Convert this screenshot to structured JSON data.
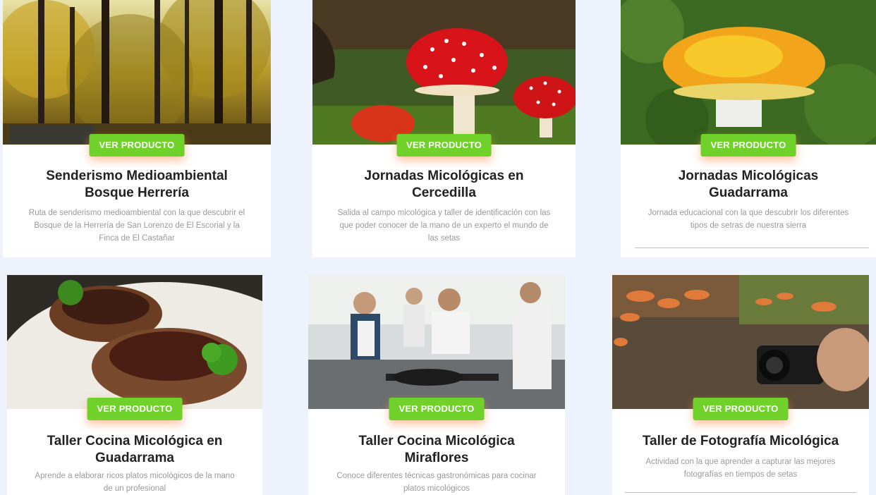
{
  "colors": {
    "button": "#6fd12a",
    "background": "#eef2fc"
  },
  "cards": [
    {
      "button": "VER PRODUCTO",
      "title": "Senderismo Medioambiental Bosque Herrería",
      "description": "Ruta de senderismo medioambiental con la que descubrir  el Bosque de la Herrería de San Lorenzo de El Escorial y la Finca de El Castañar"
    },
    {
      "button": "VER PRODUCTO",
      "title": "Jornadas Micológicas en Cercedilla",
      "description": "Salida al campo micológica y taller de identificación con las que poder conocer de la mano de un experto el mundo de las setas"
    },
    {
      "button": "VER PRODUCTO",
      "title": "Jornadas Micológicas Guadarrama",
      "description": "Jornada educacional con la que descubrir los diferentes tipos de setras de nuestra sierra"
    },
    {
      "button": "VER PRODUCTO",
      "title": "Taller Cocina Micológica en Guadarrama",
      "description": "Aprende a elaborar ricos platos micológicos de la mano de un profesional"
    },
    {
      "button": "VER PRODUCTO",
      "title": "Taller Cocina Micológica Miraflores",
      "description": "Conoce diferentes técnicas gastronómicas para cocinar platos micológicos"
    },
    {
      "button": "VER PRODUCTO",
      "title": "Taller de Fotografía Micológica",
      "description": "Actividad con la que aprender a capturar las mejores fotografías en tiempos de setas"
    }
  ]
}
